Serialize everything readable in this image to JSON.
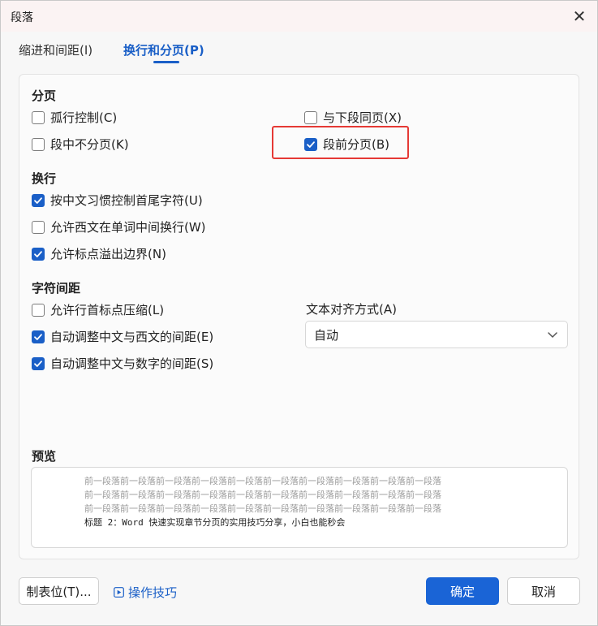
{
  "title": "段落",
  "tabs": [
    {
      "label": "缩进和间距(I)",
      "active": false
    },
    {
      "label": "换行和分页(P)",
      "active": true
    }
  ],
  "sections": {
    "pagination": "分页",
    "line_break": "换行",
    "char_spacing": "字符间距",
    "preview": "预览"
  },
  "checkboxes": {
    "widow_control": {
      "label": "孤行控制(C)",
      "checked": false
    },
    "keep_with_next": {
      "label": "与下段同页(X)",
      "checked": false
    },
    "keep_lines_together": {
      "label": "段中不分页(K)",
      "checked": false
    },
    "page_break_before": {
      "label": "段前分页(B)",
      "checked": true
    },
    "chinese_line_rules": {
      "label": "按中文习惯控制首尾字符(U)",
      "checked": true
    },
    "allow_word_wrap": {
      "label": "允许西文在单词中间换行(W)",
      "checked": false
    },
    "hanging_punct": {
      "label": "允许标点溢出边界(N)",
      "checked": true
    },
    "compress_punct": {
      "label": "允许行首标点压缩(L)",
      "checked": false
    },
    "auto_space_west": {
      "label": "自动调整中文与西文的间距(E)",
      "checked": true
    },
    "auto_space_num": {
      "label": "自动调整中文与数字的间距(S)",
      "checked": true
    }
  },
  "text_align": {
    "label": "文本对齐方式(A)",
    "value": "自动"
  },
  "preview": {
    "lines": [
      "前一段落前一段落前一段落前一段落前一段落前一段落前一段落前一段落前一段落前一段落",
      "前一段落前一段落前一段落前一段落前一段落前一段落前一段落前一段落前一段落前一段落",
      "前一段落前一段落前一段落前一段落前一段落前一段落前一段落前一段落前一段落前一段落"
    ],
    "current": "标题 2：Word 快速实现章节分页的实用技巧分享，小白也能秒会"
  },
  "buttons": {
    "tabs_btn": "制表位(T)...",
    "tips": "操作技巧",
    "ok": "确定",
    "cancel": "取消"
  },
  "colors": {
    "accent": "#1a64d6",
    "highlight": "#e53935"
  }
}
